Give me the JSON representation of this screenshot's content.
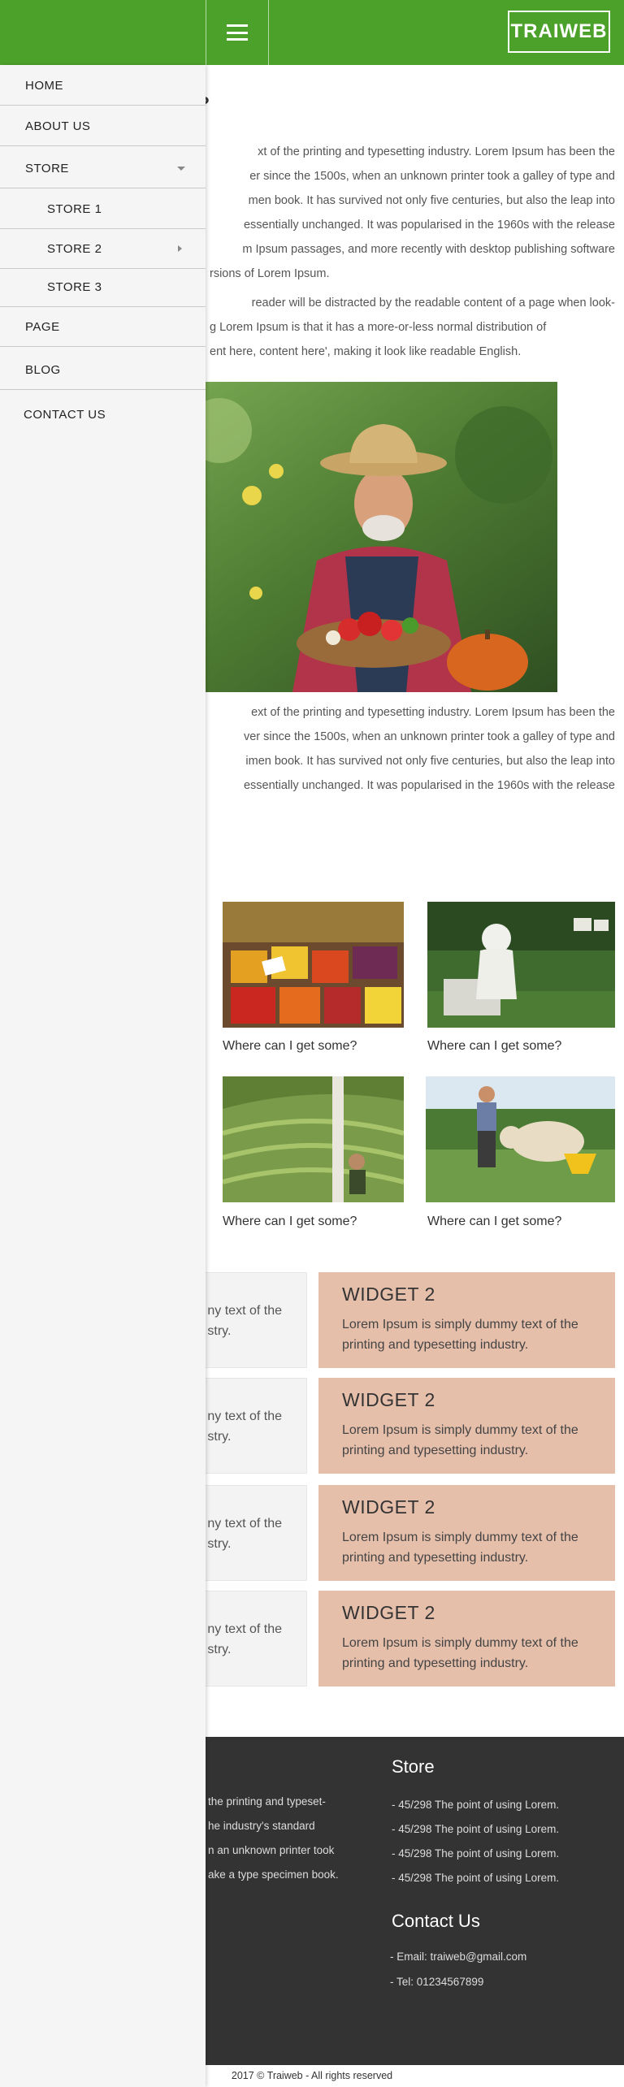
{
  "header": {
    "logo": "TRAIWEB",
    "menu_icon": "hamburger-menu-icon"
  },
  "sidebar": {
    "items": [
      {
        "label": "HOME"
      },
      {
        "label": "ABOUT US"
      },
      {
        "label": "STORE"
      },
      {
        "label": "STORE 1"
      },
      {
        "label": "STORE 2"
      },
      {
        "label": "STORE 3"
      },
      {
        "label": "PAGE"
      },
      {
        "label": "BLOG"
      },
      {
        "label": "CONTACT US"
      }
    ]
  },
  "article": {
    "title_visible": "n?",
    "para1_lines": [
      "xt of the printing and typesetting industry. Lorem Ipsum has been the",
      "er since the 1500s, when an unknown printer took a galley of type and",
      "men book. It has survived not only five centuries, but also the leap into",
      "essentially unchanged. It was popularised in the 1960s with the release",
      "m Ipsum passages, and more recently with desktop publishing software",
      "rsions of Lorem Ipsum."
    ],
    "para2_lines": [
      "reader will be distracted by the readable content of a page when look-",
      "g Lorem Ipsum is that it has a more-or-less normal distribution of",
      "ent here, content here', making it look like readable English."
    ],
    "para3_lines": [
      "ext of the printing and typesetting industry. Lorem Ipsum has been the",
      "ver since the 1500s, when an unknown printer took a galley of type and",
      "imen book. It has survived not only five centuries, but also the leap into",
      "essentially unchanged. It was popularised in the 1960s with the release"
    ]
  },
  "cards": [
    {
      "caption": "Where can I get some?"
    },
    {
      "caption": "Where can I get some?"
    },
    {
      "caption": "Where can I get some?"
    },
    {
      "caption": "Where can I get some?"
    }
  ],
  "widgets": [
    {
      "left_lines": [
        "ny text of the",
        "stry."
      ],
      "title": "WIDGET 2",
      "body": "Lorem Ipsum is simply dummy text of the printing and typesetting industry."
    },
    {
      "left_lines": [
        "ny text of the",
        "stry."
      ],
      "title": "WIDGET 2",
      "body": "Lorem Ipsum is simply dummy text of the printing and typesetting industry."
    },
    {
      "left_lines": [
        "ny text of the",
        "stry."
      ],
      "title": "WIDGET 2",
      "body": "Lorem Ipsum is simply dummy text of the printing and typesetting industry."
    },
    {
      "left_lines": [
        "ny text of the",
        "stry."
      ],
      "title": "WIDGET 2",
      "body": "Lorem Ipsum is simply dummy text of the printing and typesetting industry."
    }
  ],
  "footer": {
    "about_lines": [
      "the printing and typeset-",
      "he industry's standard",
      "n an unknown printer took",
      "ake a type specimen book."
    ],
    "store_title": "Store",
    "store_items": [
      "- 45/298 The point of using Lorem.",
      "- 45/298 The point of using Lorem.",
      "- 45/298 The point of using Lorem.",
      "- 45/298 The point of using Lorem."
    ],
    "contact_title": "Contact Us",
    "email": "- Email: traiweb@gmail.com",
    "tel": "- Tel: 01234567899",
    "copyright": "2017 © Traiweb - All rights reserved"
  },
  "colors": {
    "header_green": "#4ca12a",
    "widget_peach": "#e6bfab",
    "footer_dark": "#333333",
    "sidebar_bg": "#f5f5f5"
  }
}
